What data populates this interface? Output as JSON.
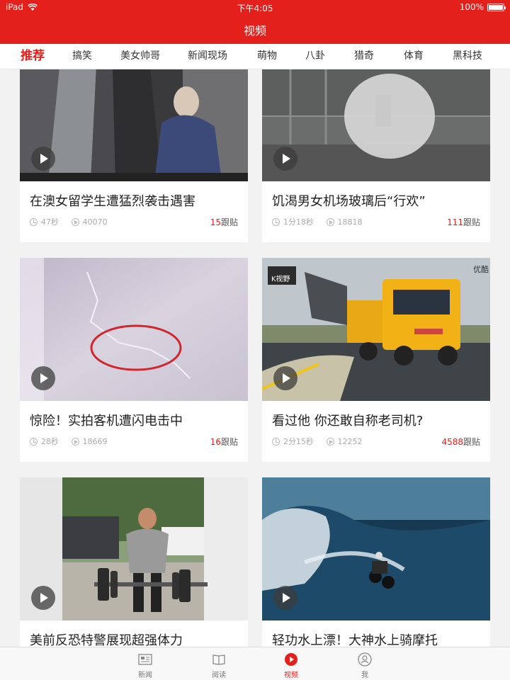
{
  "status_bar": {
    "device": "iPad",
    "time": "下午4:05",
    "battery": "100%"
  },
  "header": {
    "title": "视频"
  },
  "categories": [
    "推荐",
    "搞笑",
    "美女帅哥",
    "新闻现场",
    "萌物",
    "八卦",
    "猎奇",
    "体育",
    "黑科技"
  ],
  "active_category": "推荐",
  "cards": [
    {
      "title": "在澳女留学生遭猛烈袭击遇害",
      "duration": "47秒",
      "plays": "40070",
      "replies": "15",
      "replies_suffix": "跟贴"
    },
    {
      "title": "饥渴男女机场玻璃后“行欢”",
      "duration": "1分18秒",
      "plays": "18818",
      "replies": "111",
      "replies_suffix": "跟贴"
    },
    {
      "title": "惊险！实拍客机遭闪电击中",
      "duration": "28秒",
      "plays": "18669",
      "replies": "16",
      "replies_suffix": "跟贴"
    },
    {
      "title": "看过他 你还敢自称老司机?",
      "duration": "2分15秒",
      "plays": "12252",
      "replies": "4588",
      "replies_suffix": "跟贴"
    },
    {
      "title": "美前反恐特警展现超强体力",
      "duration": "",
      "plays": "",
      "replies": "",
      "replies_suffix": ""
    },
    {
      "title": "轻功水上漂！大神水上骑摩托",
      "duration": "",
      "plays": "",
      "replies": "",
      "replies_suffix": ""
    }
  ],
  "thumb_overlays": {
    "card4_logo": "K视野",
    "card4_corner": "优酷"
  },
  "tabbar": [
    {
      "label": "新闻",
      "icon": "news-icon"
    },
    {
      "label": "阅读",
      "icon": "book-icon"
    },
    {
      "label": "视频",
      "icon": "video-icon"
    },
    {
      "label": "我",
      "icon": "profile-icon"
    }
  ],
  "active_tab": "视频",
  "colors": {
    "brand_red": "#e3201b",
    "background": "#f2f2f2"
  }
}
